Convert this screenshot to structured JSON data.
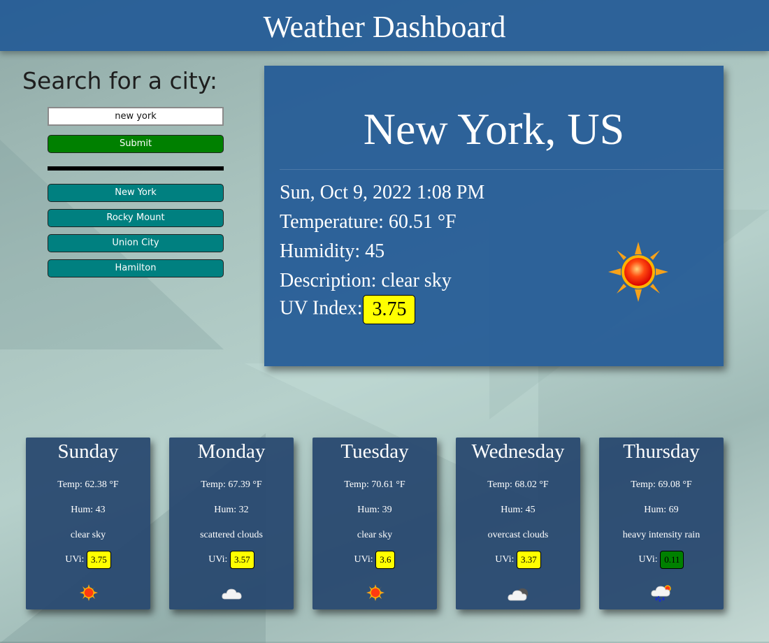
{
  "header": {
    "title": "Weather Dashboard"
  },
  "search": {
    "title": "Search for a city:",
    "input_value": "new york",
    "submit_label": "Submit",
    "history": [
      "New York",
      "Rocky Mount",
      "Union City",
      "Hamilton"
    ]
  },
  "current": {
    "city": "New York, US",
    "datetime": "Sun, Oct 9, 2022 1:08 PM",
    "temperature": "Temperature: 60.51 °F",
    "humidity": "Humidity: 45",
    "description": "Description: clear sky",
    "uv_label": "UV Index:",
    "uv_value": "3.75",
    "uv_color": "#ffff00",
    "icon": "clear-sky-sun-icon"
  },
  "forecast": [
    {
      "day": "Sunday",
      "temp": "Temp: 62.38 °F",
      "hum": "Hum: 43",
      "desc": "clear sky",
      "uv_label": "UVi:",
      "uv": "3.75",
      "uv_color": "#ffff00",
      "icon": "sun-icon"
    },
    {
      "day": "Monday",
      "temp": "Temp: 67.39 °F",
      "hum": "Hum: 32",
      "desc": "scattered clouds",
      "uv_label": "UVi:",
      "uv": "3.57",
      "uv_color": "#ffff00",
      "icon": "cloud-icon"
    },
    {
      "day": "Tuesday",
      "temp": "Temp: 70.61 °F",
      "hum": "Hum: 39",
      "desc": "clear sky",
      "uv_label": "UVi:",
      "uv": "3.6",
      "uv_color": "#ffff00",
      "icon": "sun-icon"
    },
    {
      "day": "Wednesday",
      "temp": "Temp: 68.02 °F",
      "hum": "Hum: 45",
      "desc": "overcast clouds",
      "uv_label": "UVi:",
      "uv": "3.37",
      "uv_color": "#ffff00",
      "icon": "overcast-cloud-icon"
    },
    {
      "day": "Thursday",
      "temp": "Temp: 69.08 °F",
      "hum": "Hum: 69",
      "desc": "heavy intensity rain",
      "uv_label": "UVi:",
      "uv": "0.11",
      "uv_color": "#008000",
      "icon": "rain-cloud-icon"
    }
  ]
}
